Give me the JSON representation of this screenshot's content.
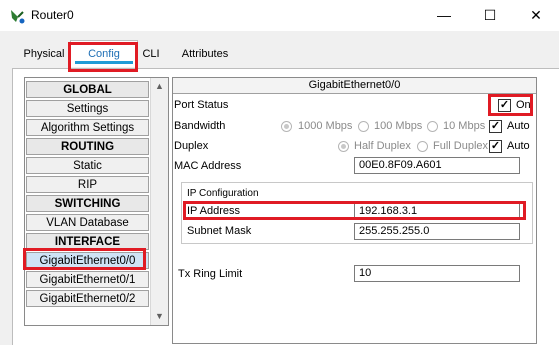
{
  "window": {
    "title": "Router0",
    "minimize": "—",
    "maximize": "☐",
    "close": "✕"
  },
  "tabs": [
    "Physical",
    "Config",
    "CLI",
    "Attributes"
  ],
  "menu": {
    "items": [
      {
        "label": "GLOBAL",
        "header": true
      },
      {
        "label": "Settings"
      },
      {
        "label": "Algorithm Settings"
      },
      {
        "label": "ROUTING",
        "header": true
      },
      {
        "label": "Static"
      },
      {
        "label": "RIP"
      },
      {
        "label": "SWITCHING",
        "header": true
      },
      {
        "label": "VLAN Database"
      },
      {
        "label": "INTERFACE",
        "header": true
      },
      {
        "label": "GigabitEthernet0/0",
        "selected": true
      },
      {
        "label": "GigabitEthernet0/1"
      },
      {
        "label": "GigabitEthernet0/2"
      }
    ]
  },
  "panel": {
    "title": "GigabitEthernet0/0",
    "port_status_label": "Port Status",
    "port_status_value": "On",
    "bandwidth_label": "Bandwidth",
    "bandwidth_options": [
      "1000 Mbps",
      "100 Mbps",
      "10 Mbps"
    ],
    "bandwidth_auto": "Auto",
    "duplex_label": "Duplex",
    "duplex_options": [
      "Half Duplex",
      "Full Duplex"
    ],
    "duplex_auto": "Auto",
    "mac_label": "MAC Address",
    "mac_value": "00E0.8F09.A601",
    "ip_config_label": "IP Configuration",
    "ip_label": "IP Address",
    "ip_value": "192.168.3.1",
    "mask_label": "Subnet Mask",
    "mask_value": "255.255.255.0",
    "tx_label": "Tx Ring Limit",
    "tx_value": "10"
  },
  "colors": {
    "highlight": "#e01b24",
    "tab_accent": "#1e9cd7"
  }
}
